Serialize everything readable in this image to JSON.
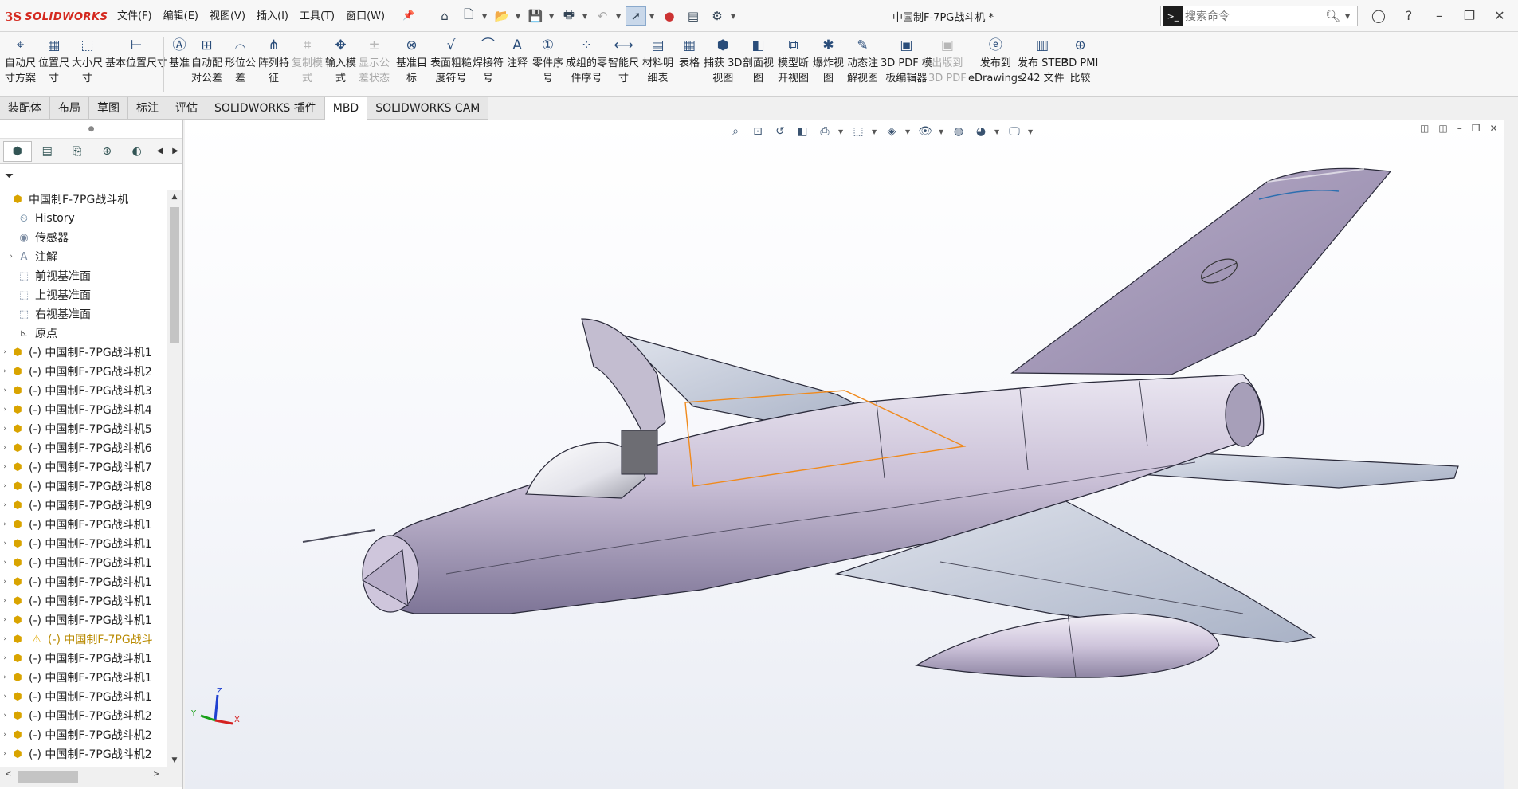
{
  "app": {
    "logo_ds": "3S",
    "logo_brand": "SOLIDWORKS",
    "document_title": "中国制F-7PG战斗机 *"
  },
  "menus": [
    "文件(F)",
    "编辑(E)",
    "视图(V)",
    "插入(I)",
    "工具(T)",
    "窗口(W)"
  ],
  "search": {
    "placeholder": "搜索命令"
  },
  "ribbon": [
    {
      "label": "自动尺\n寸方案",
      "icon": "auto-dimension-icon",
      "enabled": true
    },
    {
      "label": "位置尺\n寸",
      "icon": "location-dimension-icon",
      "enabled": true
    },
    {
      "label": "大小尺\n寸",
      "icon": "size-dimension-icon",
      "enabled": true
    },
    {
      "label": "基本位置尺寸",
      "icon": "basic-location-dimension-icon",
      "enabled": true
    },
    {
      "label": "基准",
      "icon": "datum-icon",
      "enabled": true
    },
    {
      "label": "自动配\n对公差",
      "icon": "auto-pair-tolerance-icon",
      "enabled": true
    },
    {
      "label": "形位公\n差",
      "icon": "geometric-tolerance-icon",
      "enabled": true
    },
    {
      "label": "阵列特\n征",
      "icon": "pattern-feature-icon",
      "enabled": true
    },
    {
      "label": "复制模\n式",
      "icon": "copy-scheme-icon",
      "enabled": false
    },
    {
      "label": "输入模\n式",
      "icon": "input-scheme-icon",
      "enabled": true
    },
    {
      "label": "显示公\n差状态",
      "icon": "tolerance-status-icon",
      "enabled": false
    },
    {
      "label": "基准目\n标",
      "icon": "datum-target-icon",
      "enabled": true
    },
    {
      "label": "表面粗糙\n度符号",
      "icon": "surface-finish-icon",
      "enabled": true
    },
    {
      "label": "焊接符\n号",
      "icon": "weld-symbol-icon",
      "enabled": true
    },
    {
      "label": "注释",
      "icon": "note-icon",
      "enabled": true
    },
    {
      "label": "零件序\n号",
      "icon": "balloon-icon",
      "enabled": true
    },
    {
      "label": "成组的零\n件序号",
      "icon": "stacked-balloon-icon",
      "enabled": true
    },
    {
      "label": "智能尺\n寸",
      "icon": "smart-dimension-icon",
      "enabled": true
    },
    {
      "label": "材料明\n细表",
      "icon": "bom-icon",
      "enabled": true
    },
    {
      "label": "表格",
      "icon": "table-icon",
      "enabled": true
    },
    {
      "label": "捕获 3D\n视图",
      "icon": "capture-3d-view-icon",
      "enabled": true
    },
    {
      "label": "剖面视\n图",
      "icon": "section-view-icon",
      "enabled": true
    },
    {
      "label": "模型断\n开视图",
      "icon": "model-break-view-icon",
      "enabled": true
    },
    {
      "label": "爆炸视\n图",
      "icon": "exploded-view-icon",
      "enabled": true
    },
    {
      "label": "动态注\n解视图",
      "icon": "dynamic-annotation-view-icon",
      "enabled": true
    },
    {
      "label": "3D PDF 模\n板编辑器",
      "icon": "3d-pdf-template-icon",
      "enabled": true
    },
    {
      "label": "出版到\n3D PDF",
      "icon": "publish-3d-pdf-icon",
      "enabled": false
    },
    {
      "label": "发布到\neDrawings",
      "icon": "edrawings-icon",
      "enabled": true
    },
    {
      "label": "发布 STEP\n242 文件",
      "icon": "step-242-icon",
      "enabled": true
    },
    {
      "label": "3D PMI\n比较",
      "icon": "pmi-compare-icon",
      "enabled": true
    }
  ],
  "tabs": [
    "装配体",
    "布局",
    "草图",
    "标注",
    "评估",
    "SOLIDWORKS 插件",
    "MBD",
    "SOLIDWORKS CAM"
  ],
  "active_tab": "MBD",
  "tree": {
    "root": "中国制F-7PG战斗机",
    "fixed": [
      {
        "label": "History",
        "icon": "history-icon"
      },
      {
        "label": "传感器",
        "icon": "sensor-icon"
      },
      {
        "label": "注解",
        "icon": "annotations-icon"
      },
      {
        "label": "前视基准面",
        "icon": "plane-icon"
      },
      {
        "label": "上视基准面",
        "icon": "plane-icon"
      },
      {
        "label": "右视基准面",
        "icon": "plane-icon"
      },
      {
        "label": "原点",
        "icon": "origin-icon"
      }
    ],
    "components": [
      "(-) 中国制F-7PG战斗机1",
      "(-) 中国制F-7PG战斗机2",
      "(-) 中国制F-7PG战斗机3",
      "(-) 中国制F-7PG战斗机4",
      "(-) 中国制F-7PG战斗机5",
      "(-) 中国制F-7PG战斗机6",
      "(-) 中国制F-7PG战斗机7",
      "(-) 中国制F-7PG战斗机8",
      "(-) 中国制F-7PG战斗机9",
      "(-) 中国制F-7PG战斗机1",
      "(-) 中国制F-7PG战斗机1",
      "(-) 中国制F-7PG战斗机1",
      "(-) 中国制F-7PG战斗机1",
      "(-) 中国制F-7PG战斗机1",
      "(-) 中国制F-7PG战斗机1",
      "(-) 中国制F-7PG战斗",
      "(-) 中国制F-7PG战斗机1",
      "(-) 中国制F-7PG战斗机1",
      "(-) 中国制F-7PG战斗机1",
      "(-) 中国制F-7PG战斗机2",
      "(-) 中国制F-7PG战斗机2",
      "(-) 中国制F-7PG战斗机2"
    ],
    "warning_index": 15
  },
  "triad": {
    "x": "X",
    "y": "Y",
    "z": "Z"
  },
  "colors": {
    "jet_body": "#c9bfd6",
    "jet_shadow": "#8f84a6",
    "accent_orange": "#f08a1c",
    "triad_x": "#d42020",
    "triad_y": "#18a018",
    "triad_z": "#1f40d0"
  }
}
